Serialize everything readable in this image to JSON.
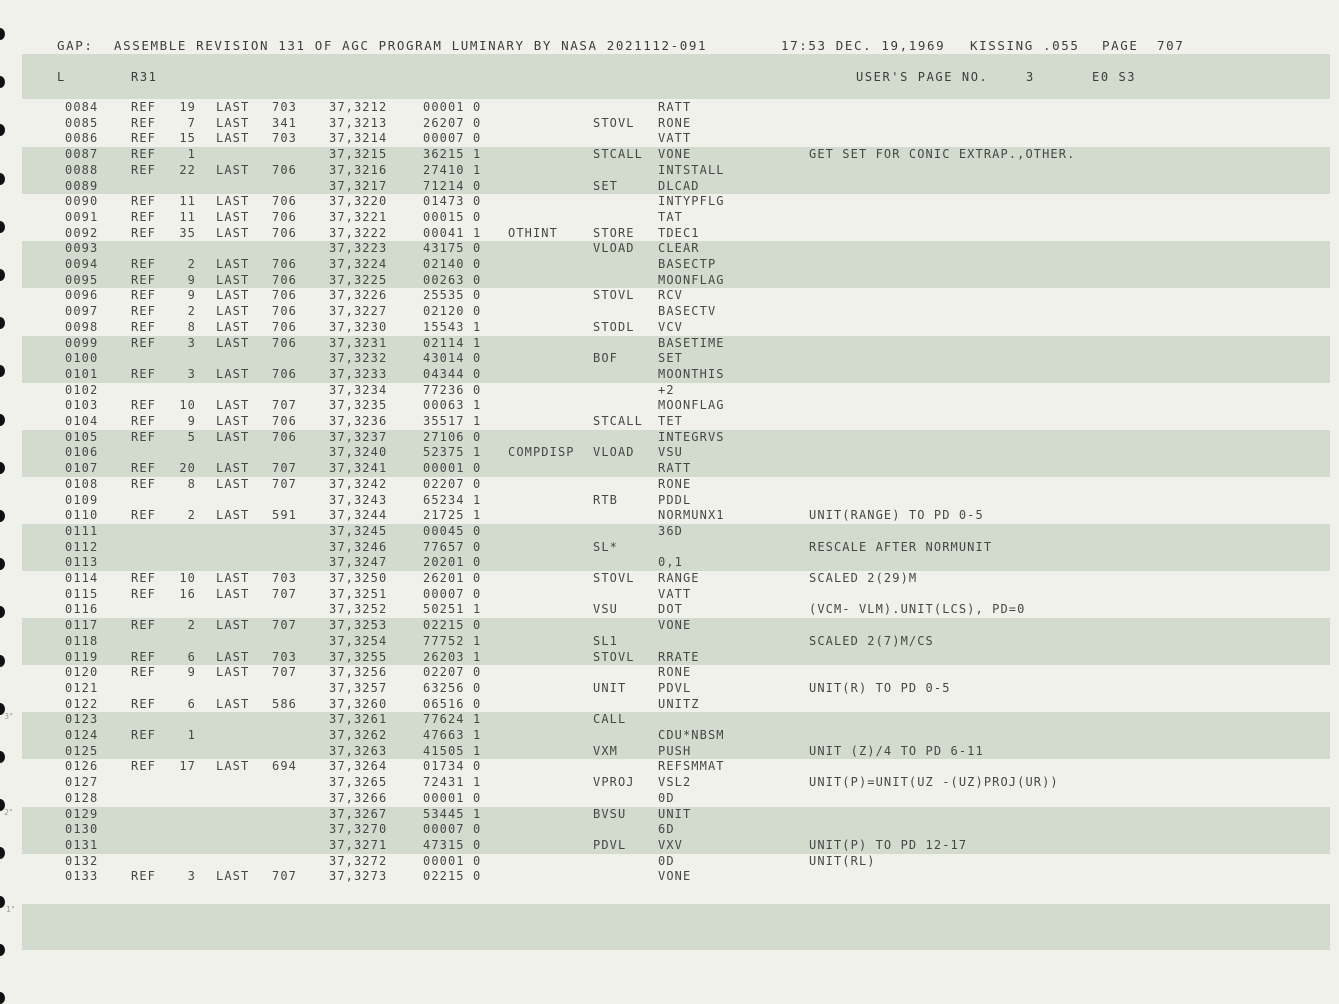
{
  "header": {
    "source": "GAP:",
    "title": "ASSEMBLE REVISION 131 OF AGC PROGRAM LUMINARY BY NASA 2021112-091",
    "time": "17:53 DEC. 19,1969",
    "name": "KISSING .055",
    "page_label": "PAGE",
    "page_number": "707"
  },
  "subheader": {
    "type": "L",
    "section": "R31",
    "users_page_label": "USER'S PAGE NO.",
    "users_page_number": "3",
    "set": "E0 S3"
  },
  "margin_marks": [
    "3\"",
    "2\"",
    "1\""
  ],
  "rows": [
    {
      "line": "0084",
      "ref": "REF",
      "refn": "19",
      "last": "LAST",
      "lastn": "703",
      "addr": "37,3212",
      "code": "00001 0",
      "label": "",
      "op": "",
      "arg": "RATT",
      "cmt": ""
    },
    {
      "line": "0085",
      "ref": "REF",
      "refn": "7",
      "last": "LAST",
      "lastn": "341",
      "addr": "37,3213",
      "code": "26207 0",
      "label": "",
      "op": "STOVL",
      "arg": "RONE",
      "cmt": ""
    },
    {
      "line": "0086",
      "ref": "REF",
      "refn": "15",
      "last": "LAST",
      "lastn": "703",
      "addr": "37,3214",
      "code": "00007 0",
      "label": "",
      "op": "",
      "arg": "VATT",
      "cmt": ""
    },
    {
      "line": "0087",
      "ref": "REF",
      "refn": "1",
      "last": "",
      "lastn": "",
      "addr": "37,3215",
      "code": "36215 1",
      "label": "",
      "op": "STCALL",
      "arg": "VONE",
      "cmt": "GET SET FOR CONIC EXTRAP.,OTHER."
    },
    {
      "line": "0088",
      "ref": "REF",
      "refn": "22",
      "last": "LAST",
      "lastn": "706",
      "addr": "37,3216",
      "code": "27410 1",
      "label": "",
      "op": "",
      "arg": "INTSTALL",
      "cmt": ""
    },
    {
      "line": "0089",
      "ref": "",
      "refn": "",
      "last": "",
      "lastn": "",
      "addr": "37,3217",
      "code": "71214 0",
      "label": "",
      "op": "SET",
      "arg": "DLCAD",
      "cmt": ""
    },
    {
      "line": "0090",
      "ref": "REF",
      "refn": "11",
      "last": "LAST",
      "lastn": "706",
      "addr": "37,3220",
      "code": "01473 0",
      "label": "",
      "op": "",
      "arg": "INTYPFLG",
      "cmt": ""
    },
    {
      "line": "0091",
      "ref": "REF",
      "refn": "11",
      "last": "LAST",
      "lastn": "706",
      "addr": "37,3221",
      "code": "00015 0",
      "label": "",
      "op": "",
      "arg": "TAT",
      "cmt": ""
    },
    {
      "line": "0092",
      "ref": "REF",
      "refn": "35",
      "last": "LAST",
      "lastn": "706",
      "addr": "37,3222",
      "code": "00041 1",
      "label": "OTHINT",
      "op": "STORE",
      "arg": "TDEC1",
      "cmt": ""
    },
    {
      "line": "0093",
      "ref": "",
      "refn": "",
      "last": "",
      "lastn": "",
      "addr": "37,3223",
      "code": "43175 0",
      "label": "",
      "op": "VLOAD",
      "arg": "CLEAR",
      "cmt": ""
    },
    {
      "line": "0094",
      "ref": "REF",
      "refn": "2",
      "last": "LAST",
      "lastn": "706",
      "addr": "37,3224",
      "code": "02140 0",
      "label": "",
      "op": "",
      "arg": "BASECTP",
      "cmt": ""
    },
    {
      "line": "0095",
      "ref": "REF",
      "refn": "9",
      "last": "LAST",
      "lastn": "706",
      "addr": "37,3225",
      "code": "00263 0",
      "label": "",
      "op": "",
      "arg": "MOONFLAG",
      "cmt": ""
    },
    {
      "line": "0096",
      "ref": "REF",
      "refn": "9",
      "last": "LAST",
      "lastn": "706",
      "addr": "37,3226",
      "code": "25535 0",
      "label": "",
      "op": "STOVL",
      "arg": "RCV",
      "cmt": ""
    },
    {
      "line": "0097",
      "ref": "REF",
      "refn": "2",
      "last": "LAST",
      "lastn": "706",
      "addr": "37,3227",
      "code": "02120 0",
      "label": "",
      "op": "",
      "arg": "BASECTV",
      "cmt": ""
    },
    {
      "line": "0098",
      "ref": "REF",
      "refn": "8",
      "last": "LAST",
      "lastn": "706",
      "addr": "37,3230",
      "code": "15543 1",
      "label": "",
      "op": "STODL",
      "arg": "VCV",
      "cmt": ""
    },
    {
      "line": "0099",
      "ref": "REF",
      "refn": "3",
      "last": "LAST",
      "lastn": "706",
      "addr": "37,3231",
      "code": "02114 1",
      "label": "",
      "op": "",
      "arg": "BASETIME",
      "cmt": ""
    },
    {
      "line": "0100",
      "ref": "",
      "refn": "",
      "last": "",
      "lastn": "",
      "addr": "37,3232",
      "code": "43014 0",
      "label": "",
      "op": "BOF",
      "arg": "SET",
      "cmt": ""
    },
    {
      "line": "0101",
      "ref": "REF",
      "refn": "3",
      "last": "LAST",
      "lastn": "706",
      "addr": "37,3233",
      "code": "04344 0",
      "label": "",
      "op": "",
      "arg": "MOONTHIS",
      "cmt": ""
    },
    {
      "line": "0102",
      "ref": "",
      "refn": "",
      "last": "",
      "lastn": "",
      "addr": "37,3234",
      "code": "77236 0",
      "label": "",
      "op": "",
      "arg": "+2",
      "cmt": ""
    },
    {
      "line": "0103",
      "ref": "REF",
      "refn": "10",
      "last": "LAST",
      "lastn": "707",
      "addr": "37,3235",
      "code": "00063 1",
      "label": "",
      "op": "",
      "arg": "MOONFLAG",
      "cmt": ""
    },
    {
      "line": "0104",
      "ref": "REF",
      "refn": "9",
      "last": "LAST",
      "lastn": "706",
      "addr": "37,3236",
      "code": "35517 1",
      "label": "",
      "op": "STCALL",
      "arg": "TET",
      "cmt": ""
    },
    {
      "line": "0105",
      "ref": "REF",
      "refn": "5",
      "last": "LAST",
      "lastn": "706",
      "addr": "37,3237",
      "code": "27106 0",
      "label": "",
      "op": "",
      "arg": "INTEGRVS",
      "cmt": ""
    },
    {
      "line": "0106",
      "ref": "",
      "refn": "",
      "last": "",
      "lastn": "",
      "addr": "37,3240",
      "code": "52375 1",
      "label": "COMPDISP",
      "op": "VLOAD",
      "arg": "VSU",
      "cmt": ""
    },
    {
      "line": "0107",
      "ref": "REF",
      "refn": "20",
      "last": "LAST",
      "lastn": "707",
      "addr": "37,3241",
      "code": "00001 0",
      "label": "",
      "op": "",
      "arg": "RATT",
      "cmt": ""
    },
    {
      "line": "0108",
      "ref": "REF",
      "refn": "8",
      "last": "LAST",
      "lastn": "707",
      "addr": "37,3242",
      "code": "02207 0",
      "label": "",
      "op": "",
      "arg": "RONE",
      "cmt": ""
    },
    {
      "line": "0109",
      "ref": "",
      "refn": "",
      "last": "",
      "lastn": "",
      "addr": "37,3243",
      "code": "65234 1",
      "label": "",
      "op": "RTB",
      "arg": "PDDL",
      "cmt": ""
    },
    {
      "line": "0110",
      "ref": "REF",
      "refn": "2",
      "last": "LAST",
      "lastn": "591",
      "addr": "37,3244",
      "code": "21725 1",
      "label": "",
      "op": "",
      "arg": "NORMUNX1",
      "cmt": "UNIT(RANGE) TO PD 0-5"
    },
    {
      "line": "0111",
      "ref": "",
      "refn": "",
      "last": "",
      "lastn": "",
      "addr": "37,3245",
      "code": "00045 0",
      "label": "",
      "op": "",
      "arg": "36D",
      "cmt": ""
    },
    {
      "line": "0112",
      "ref": "",
      "refn": "",
      "last": "",
      "lastn": "",
      "addr": "37,3246",
      "code": "77657 0",
      "label": "",
      "op": "SL*",
      "arg": "",
      "cmt": "RESCALE AFTER NORMUNIT"
    },
    {
      "line": "0113",
      "ref": "",
      "refn": "",
      "last": "",
      "lastn": "",
      "addr": "37,3247",
      "code": "20201 0",
      "label": "",
      "op": "",
      "arg": "0,1",
      "cmt": ""
    },
    {
      "line": "0114",
      "ref": "REF",
      "refn": "10",
      "last": "LAST",
      "lastn": "703",
      "addr": "37,3250",
      "code": "26201 0",
      "label": "",
      "op": "STOVL",
      "arg": "RANGE",
      "cmt": "SCALED 2(29)M"
    },
    {
      "line": "0115",
      "ref": "REF",
      "refn": "16",
      "last": "LAST",
      "lastn": "707",
      "addr": "37,3251",
      "code": "00007 0",
      "label": "",
      "op": "",
      "arg": "VATT",
      "cmt": ""
    },
    {
      "line": "0116",
      "ref": "",
      "refn": "",
      "last": "",
      "lastn": "",
      "addr": "37,3252",
      "code": "50251 1",
      "label": "",
      "op": "VSU",
      "arg": "DOT",
      "cmt": "(VCM- VLM).UNIT(LCS), PD=0"
    },
    {
      "line": "0117",
      "ref": "REF",
      "refn": "2",
      "last": "LAST",
      "lastn": "707",
      "addr": "37,3253",
      "code": "02215 0",
      "label": "",
      "op": "",
      "arg": "VONE",
      "cmt": ""
    },
    {
      "line": "0118",
      "ref": "",
      "refn": "",
      "last": "",
      "lastn": "",
      "addr": "37,3254",
      "code": "77752 1",
      "label": "",
      "op": "SL1",
      "arg": "",
      "cmt": "SCALED 2(7)M/CS"
    },
    {
      "line": "0119",
      "ref": "REF",
      "refn": "6",
      "last": "LAST",
      "lastn": "703",
      "addr": "37,3255",
      "code": "26203 1",
      "label": "",
      "op": "STOVL",
      "arg": "RRATE",
      "cmt": ""
    },
    {
      "line": "0120",
      "ref": "REF",
      "refn": "9",
      "last": "LAST",
      "lastn": "707",
      "addr": "37,3256",
      "code": "02207 0",
      "label": "",
      "op": "",
      "arg": "RONE",
      "cmt": ""
    },
    {
      "line": "0121",
      "ref": "",
      "refn": "",
      "last": "",
      "lastn": "",
      "addr": "37,3257",
      "code": "63256 0",
      "label": "",
      "op": "UNIT",
      "arg": "PDVL",
      "cmt": "UNIT(R) TO PD 0-5"
    },
    {
      "line": "0122",
      "ref": "REF",
      "refn": "6",
      "last": "LAST",
      "lastn": "586",
      "addr": "37,3260",
      "code": "06516 0",
      "label": "",
      "op": "",
      "arg": "UNITZ",
      "cmt": ""
    },
    {
      "line": "0123",
      "ref": "",
      "refn": "",
      "last": "",
      "lastn": "",
      "addr": "37,3261",
      "code": "77624 1",
      "label": "",
      "op": "CALL",
      "arg": "",
      "cmt": ""
    },
    {
      "line": "0124",
      "ref": "REF",
      "refn": "1",
      "last": "",
      "lastn": "",
      "addr": "37,3262",
      "code": "47663 1",
      "label": "",
      "op": "",
      "arg": "CDU*NBSM",
      "cmt": ""
    },
    {
      "line": "0125",
      "ref": "",
      "refn": "",
      "last": "",
      "lastn": "",
      "addr": "37,3263",
      "code": "41505 1",
      "label": "",
      "op": "VXM",
      "arg": "PUSH",
      "cmt": "UNIT (Z)/4 TO PD 6-11"
    },
    {
      "line": "0126",
      "ref": "REF",
      "refn": "17",
      "last": "LAST",
      "lastn": "694",
      "addr": "37,3264",
      "code": "01734 0",
      "label": "",
      "op": "",
      "arg": "REFSMMAT",
      "cmt": ""
    },
    {
      "line": "0127",
      "ref": "",
      "refn": "",
      "last": "",
      "lastn": "",
      "addr": "37,3265",
      "code": "72431 1",
      "label": "",
      "op": "VPROJ",
      "arg": "VSL2",
      "cmt": "UNIT(P)=UNIT(UZ -(UZ)PROJ(UR))"
    },
    {
      "line": "0128",
      "ref": "",
      "refn": "",
      "last": "",
      "lastn": "",
      "addr": "37,3266",
      "code": "00001 0",
      "label": "",
      "op": "",
      "arg": "0D",
      "cmt": ""
    },
    {
      "line": "0129",
      "ref": "",
      "refn": "",
      "last": "",
      "lastn": "",
      "addr": "37,3267",
      "code": "53445 1",
      "label": "",
      "op": "BVSU",
      "arg": "UNIT",
      "cmt": ""
    },
    {
      "line": "0130",
      "ref": "",
      "refn": "",
      "last": "",
      "lastn": "",
      "addr": "37,3270",
      "code": "00007 0",
      "label": "",
      "op": "",
      "arg": "6D",
      "cmt": ""
    },
    {
      "line": "0131",
      "ref": "",
      "refn": "",
      "last": "",
      "lastn": "",
      "addr": "37,3271",
      "code": "47315 0",
      "label": "",
      "op": "PDVL",
      "arg": "VXV",
      "cmt": "UNIT(P) TO PD 12-17"
    },
    {
      "line": "0132",
      "ref": "",
      "refn": "",
      "last": "",
      "lastn": "",
      "addr": "37,3272",
      "code": "00001 0",
      "label": "",
      "op": "",
      "arg": "0D",
      "cmt": "UNIT(RL)"
    },
    {
      "line": "0133",
      "ref": "REF",
      "refn": "3",
      "last": "LAST",
      "lastn": "707",
      "addr": "37,3273",
      "code": "02215 0",
      "label": "",
      "op": "",
      "arg": "VONE",
      "cmt": ""
    }
  ]
}
